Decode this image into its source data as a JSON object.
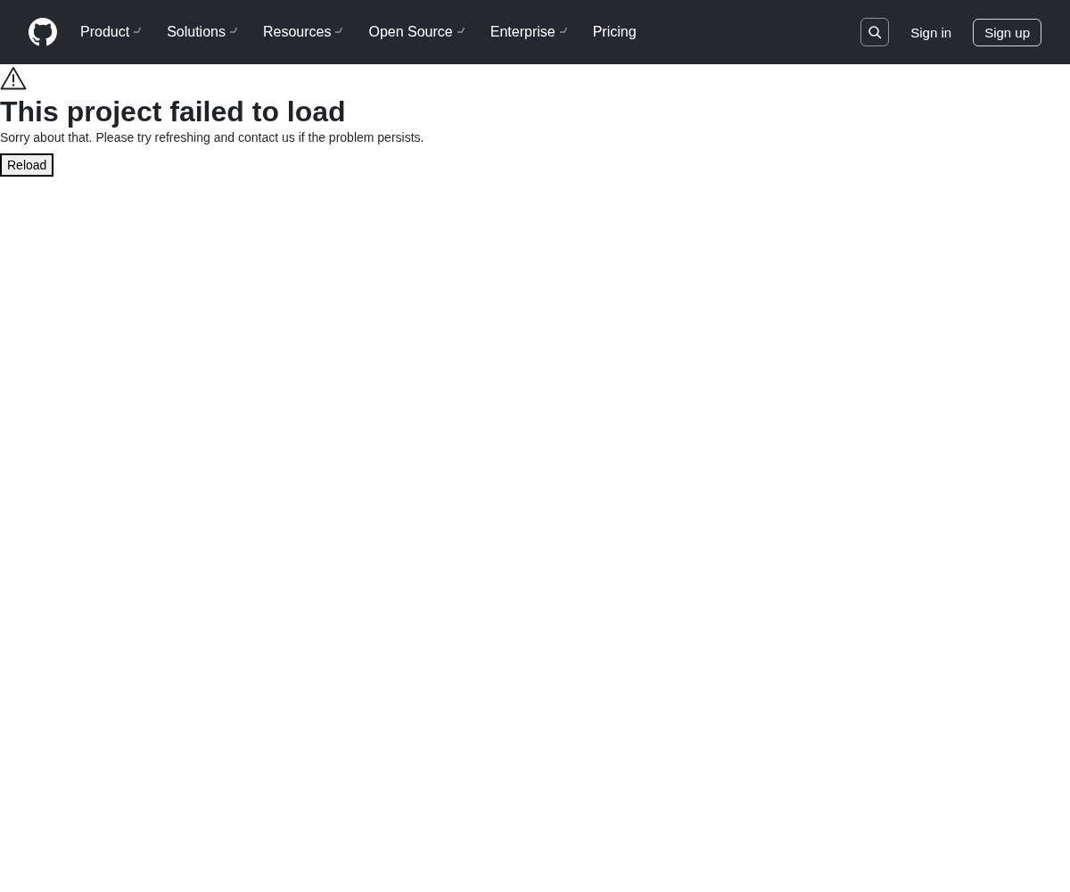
{
  "header": {
    "nav": [
      {
        "label": "Product",
        "kind": "menu"
      },
      {
        "label": "Solutions",
        "kind": "menu"
      },
      {
        "label": "Resources",
        "kind": "menu"
      },
      {
        "label": "Open Source",
        "kind": "menu"
      },
      {
        "label": "Enterprise",
        "kind": "menu"
      },
      {
        "label": "Pricing",
        "kind": "link"
      }
    ],
    "sign_in": "Sign in",
    "sign_up": "Sign up"
  },
  "error": {
    "title": "This project failed to load",
    "message": "Sorry about that. Please try refreshing and contact us if the problem persists.",
    "button": "Reload"
  }
}
